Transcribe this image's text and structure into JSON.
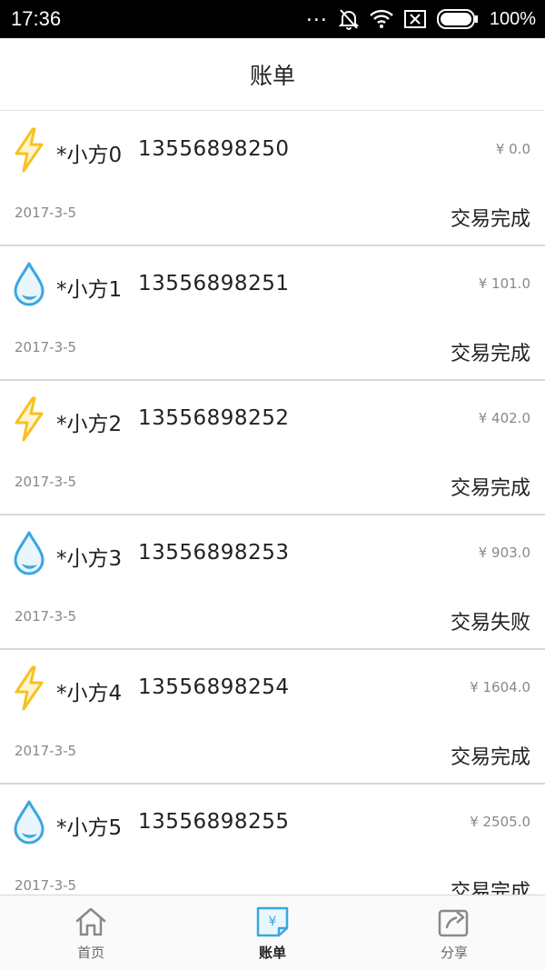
{
  "status_bar": {
    "time": "17:36",
    "dots": "...",
    "battery_text": "100%",
    "icons": [
      "mute-bell-icon",
      "wifi-icon",
      "sim-off-icon",
      "battery-icon"
    ]
  },
  "header": {
    "title": "账单"
  },
  "bills": [
    {
      "icon": "lightning-icon",
      "name": "*小方0",
      "phone": "13556898250",
      "amount": "¥ 0.0",
      "date": "2017-3-5",
      "status": "交易完成"
    },
    {
      "icon": "water-drop-icon",
      "name": "*小方1",
      "phone": "13556898251",
      "amount": "¥ 101.0",
      "date": "2017-3-5",
      "status": "交易完成"
    },
    {
      "icon": "lightning-icon",
      "name": "*小方2",
      "phone": "13556898252",
      "amount": "¥ 402.0",
      "date": "2017-3-5",
      "status": "交易完成"
    },
    {
      "icon": "water-drop-icon",
      "name": "*小方3",
      "phone": "13556898253",
      "amount": "¥ 903.0",
      "date": "2017-3-5",
      "status": "交易失败"
    },
    {
      "icon": "lightning-icon",
      "name": "*小方4",
      "phone": "13556898254",
      "amount": "¥ 1604.0",
      "date": "2017-3-5",
      "status": "交易完成"
    },
    {
      "icon": "water-drop-icon",
      "name": "*小方5",
      "phone": "13556898255",
      "amount": "¥ 2505.0",
      "date": "2017-3-5",
      "status": "交易完成"
    }
  ],
  "nav": {
    "home": "首页",
    "bills": "账单",
    "share": "分享",
    "active": "bills"
  },
  "colors": {
    "lightning": "#f6c123",
    "water": "#3aa6e0",
    "status_bar_bg": "#000000",
    "nav_active": "#3aa6e0",
    "nav_inactive": "#888888"
  }
}
